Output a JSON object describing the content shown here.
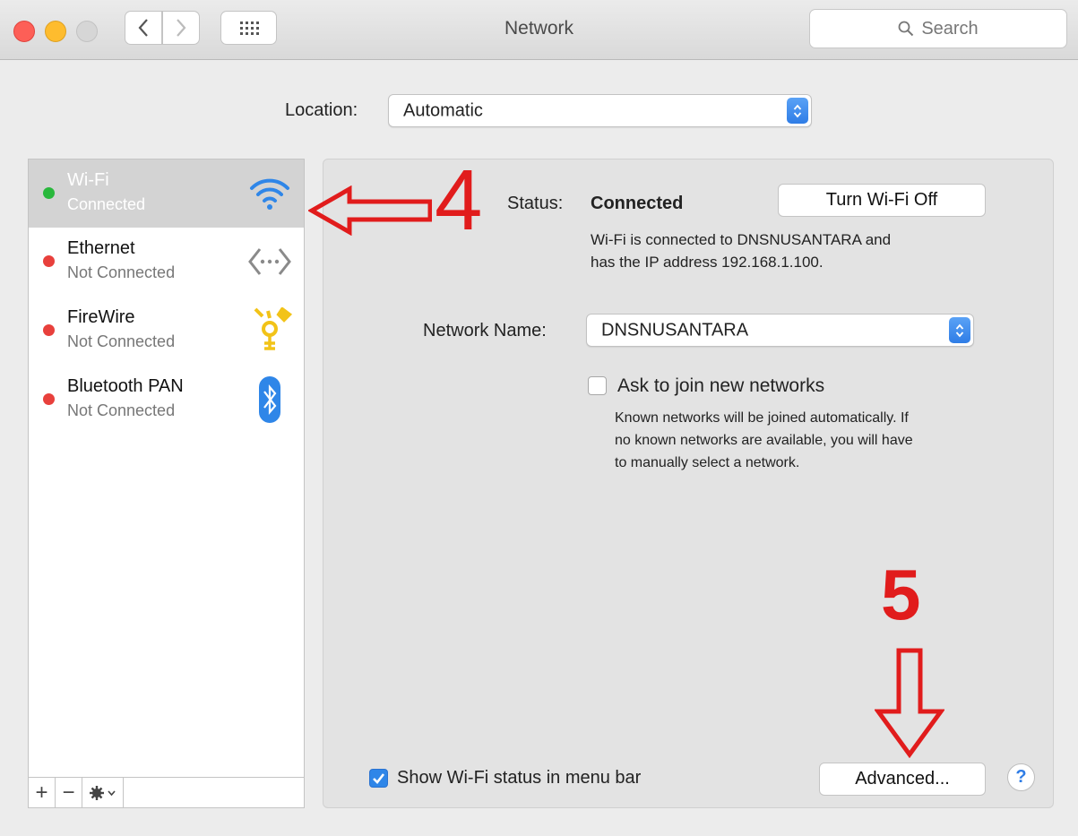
{
  "window": {
    "title": "Network"
  },
  "search": {
    "placeholder": "Search"
  },
  "location": {
    "label": "Location:",
    "value": "Automatic"
  },
  "services": [
    {
      "name": "Wi-Fi",
      "status": "Connected",
      "icon": "wifi-icon",
      "dot_color": "#29b83c",
      "selected": true
    },
    {
      "name": "Ethernet",
      "status": "Not Connected",
      "icon": "ethernet-icon",
      "dot_color": "#e8403c",
      "selected": false
    },
    {
      "name": "FireWire",
      "status": "Not Connected",
      "icon": "firewire-icon",
      "dot_color": "#e8403c",
      "selected": false
    },
    {
      "name": "Bluetooth PAN",
      "status": "Not Connected",
      "icon": "bluetooth-icon",
      "dot_color": "#e8403c",
      "selected": false
    }
  ],
  "sidebar_footer": {
    "add": "+",
    "remove": "−"
  },
  "detail": {
    "status_label": "Status:",
    "status_value": "Connected",
    "turn_off_button": "Turn Wi-Fi Off",
    "status_desc_line1": "Wi-Fi is connected to DNSNUSANTARA and",
    "status_desc_line2": "has the IP address 192.168.1.100.",
    "network_name_label": "Network Name:",
    "network_name_value": "DNSNUSANTARA",
    "ask_join_label": "Ask to join new networks",
    "ask_join_checked": false,
    "ask_join_desc_line1": "Known networks will be joined automatically. If",
    "ask_join_desc_line2": "no known networks are available, you will have",
    "ask_join_desc_line3": "to manually select a network.",
    "show_status_label": "Show Wi-Fi status in menu bar",
    "show_status_checked": true,
    "advanced_button": "Advanced...",
    "help": "?"
  },
  "annotations": {
    "step4": "4",
    "step5": "5"
  },
  "colors": {
    "accent": "#2f7de6",
    "annotation": "#e11c1c"
  }
}
